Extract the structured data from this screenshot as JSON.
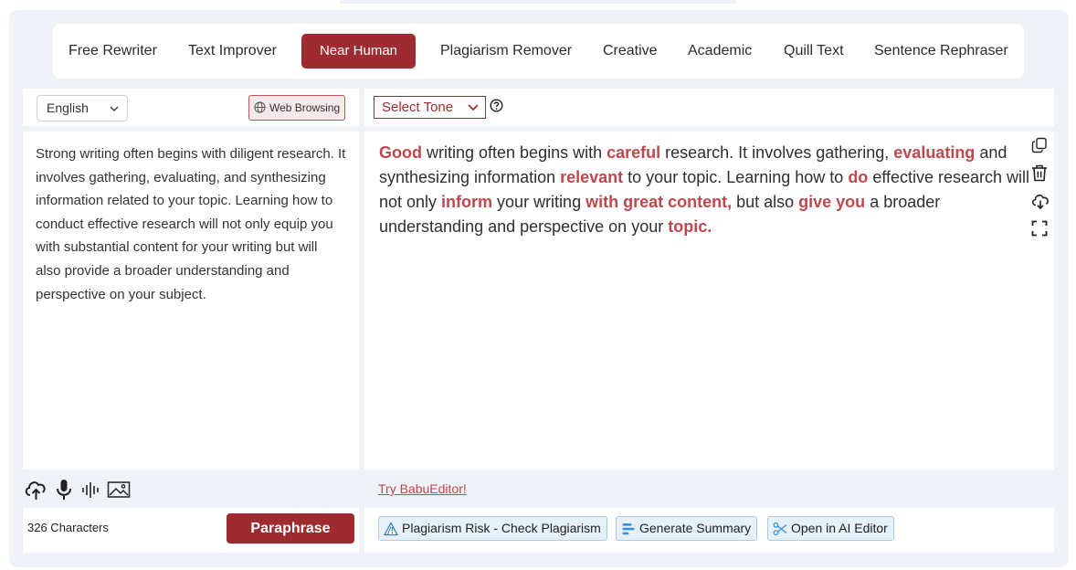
{
  "tabs": [
    {
      "label": "Free Rewriter"
    },
    {
      "label": "Text Improver"
    },
    {
      "label": "Near Human",
      "active": true
    },
    {
      "label": "Plagiarism Remover"
    },
    {
      "label": "Creative"
    },
    {
      "label": "Academic"
    },
    {
      "label": "Quill Text"
    },
    {
      "label": "Sentence Rephraser"
    }
  ],
  "input": {
    "language": "English",
    "web_browsing_label": "Web Browsing",
    "text": "Strong writing often begins with diligent research. It involves gathering, evaluating, and synthesizing information related to your topic. Learning how to conduct effective research will not only equip you with substantial content for your writing but will also provide a broader understanding and perspective on your subject.",
    "char_count": "326 Characters",
    "paraphrase_label": "Paraphrase",
    "tool_icons": [
      "upload-cloud-icon",
      "microphone-icon",
      "audio-wave-icon",
      "image-icon"
    ]
  },
  "output": {
    "tone_label": "Select Tone",
    "segments": [
      {
        "text": "Good",
        "hl": true
      },
      {
        "text": " writing often begins with ",
        "hl": false
      },
      {
        "text": "careful",
        "hl": true
      },
      {
        "text": " research. It involves gathering, ",
        "hl": false
      },
      {
        "text": "evaluating",
        "hl": true
      },
      {
        "text": " and synthesizing information ",
        "hl": false
      },
      {
        "text": "relevant",
        "hl": true
      },
      {
        "text": " to your topic. Learning how to ",
        "hl": false
      },
      {
        "text": "do",
        "hl": true
      },
      {
        "text": " effective research will not only ",
        "hl": false
      },
      {
        "text": "inform",
        "hl": true
      },
      {
        "text": " your writing ",
        "hl": false
      },
      {
        "text": "with great content,",
        "hl": true
      },
      {
        "text": " but also ",
        "hl": false
      },
      {
        "text": "give you",
        "hl": true
      },
      {
        "text": " a broader understanding and perspective on your ",
        "hl": false
      },
      {
        "text": "topic.",
        "hl": true
      }
    ],
    "side_icons": [
      "copy-icon",
      "trash-icon",
      "download-icon",
      "fullscreen-icon"
    ],
    "try_link": "Try BabuEditor!",
    "actions": [
      {
        "label": "Plagiarism Risk - Check Plagiarism",
        "icon": "warning-triangle-icon"
      },
      {
        "label": "Generate Summary",
        "icon": "summary-bars-icon"
      },
      {
        "label": "Open in AI Editor",
        "icon": "ai-editor-icon"
      }
    ]
  },
  "colors": {
    "accent": "#9e2b2f",
    "highlight": "#c0474c",
    "chip_bg": "#e6f1fa",
    "panel_bg": "#eff2f6"
  }
}
